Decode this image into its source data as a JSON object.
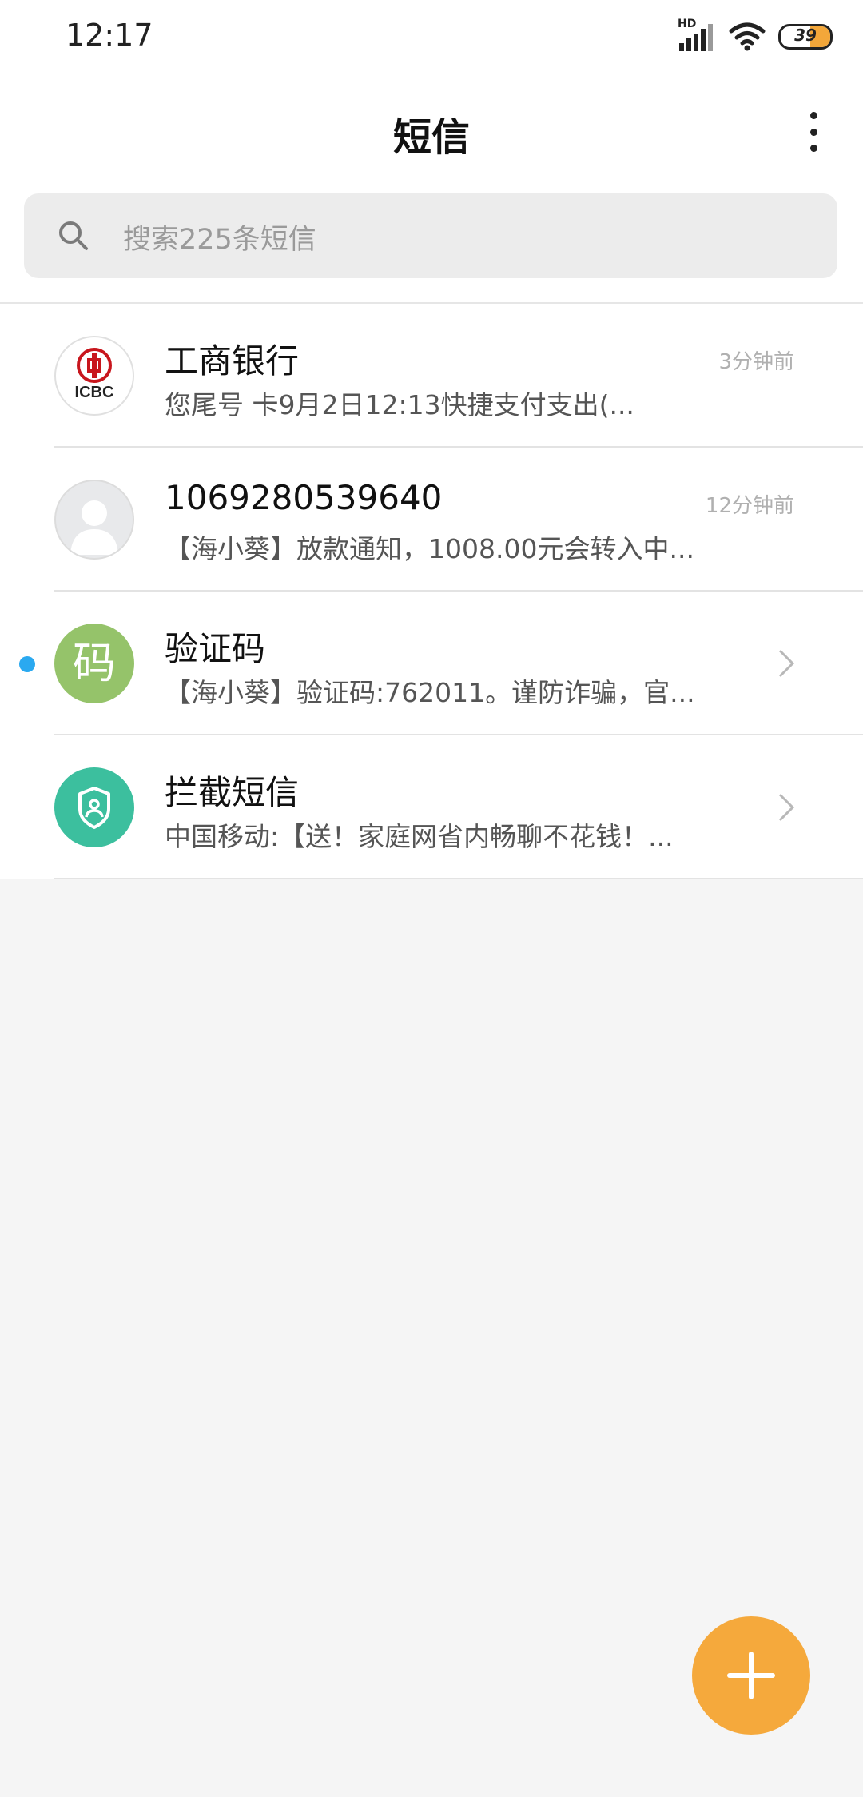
{
  "status_bar": {
    "time": "12:17",
    "network_label": "HD",
    "battery_level": "39",
    "icons": [
      "signal-icon",
      "wifi-icon",
      "battery-icon"
    ]
  },
  "header": {
    "title": "短信",
    "more_icon": "more-vertical-icon"
  },
  "search": {
    "placeholder": "搜索225条短信",
    "icon": "search-icon"
  },
  "conversations": [
    {
      "name": "工商银行",
      "preview": "您尾号 卡9月2日12:13快捷支付支出(...",
      "time": "3分钟前",
      "avatar": "ICBC",
      "unread": false
    },
    {
      "name": "1069280539640",
      "preview": "【海小葵】放款通知，1008.00元会转入中...",
      "time": "12分钟前",
      "avatar": "default-avatar",
      "unread": false
    },
    {
      "name": "验证码",
      "preview": "【海小葵】验证码:762011。谨防诈骗，官...",
      "avatar": "码",
      "unread": true
    },
    {
      "name": "拦截短信",
      "preview": "中国移动:【送！家庭网省内畅聊不花钱！...",
      "avatar": "shield-icon",
      "unread": false
    }
  ],
  "colors": {
    "unread_dot": "#2aa9f0",
    "fab": "#f5a93c",
    "code_avatar": "#95c36a",
    "shield_avatar": "#3cbf9e",
    "icbc_red": "#c8161d"
  },
  "fab": {
    "icon": "plus-icon"
  }
}
